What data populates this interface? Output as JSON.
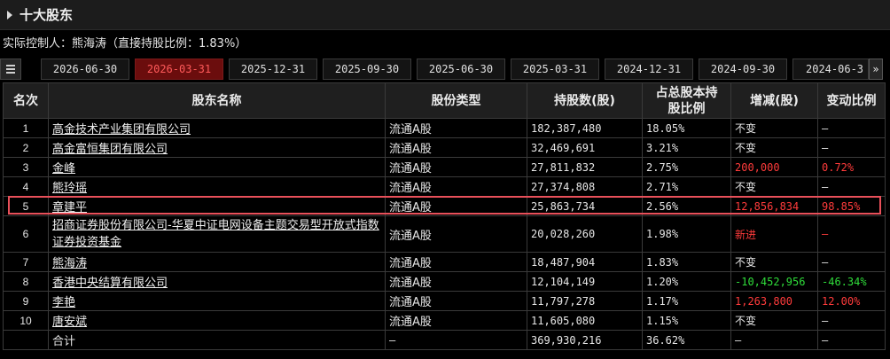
{
  "header": {
    "title": "十大股东"
  },
  "controller": {
    "text": "实际控制人：熊海涛（直接持股比例：1.83%）"
  },
  "tabs": [
    {
      "label": "2026-06-30",
      "active": false
    },
    {
      "label": "2026-03-31",
      "active": true
    },
    {
      "label": "2025-12-31",
      "active": false
    },
    {
      "label": "2025-09-30",
      "active": false
    },
    {
      "label": "2025-06-30",
      "active": false
    },
    {
      "label": "2025-03-31",
      "active": false
    },
    {
      "label": "2024-12-31",
      "active": false
    },
    {
      "label": "2024-09-30",
      "active": false
    },
    {
      "label": "2024-06-3",
      "active": false
    }
  ],
  "tab_next_icon": "double-chevron-right-icon",
  "table": {
    "headers": [
      "名次",
      "股东名称",
      "股份类型",
      "持股数(股)",
      "占总股本持股比例",
      "增减(股)",
      "变动比例"
    ],
    "rows": [
      {
        "rank": "1",
        "name": "高金技术产业集团有限公司",
        "type": "流通A股",
        "shares": "182,387,480",
        "pct": "18.05%",
        "change": "不变",
        "change_pct": "—",
        "dir": "none"
      },
      {
        "rank": "2",
        "name": "高金富恒集团有限公司",
        "type": "流通A股",
        "shares": "32,469,691",
        "pct": "3.21%",
        "change": "不变",
        "change_pct": "—",
        "dir": "none"
      },
      {
        "rank": "3",
        "name": "金峰",
        "type": "流通A股",
        "shares": "27,811,832",
        "pct": "2.75%",
        "change": "200,000",
        "change_pct": "0.72%",
        "dir": "up"
      },
      {
        "rank": "4",
        "name": "熊玲瑶",
        "type": "流通A股",
        "shares": "27,374,808",
        "pct": "2.71%",
        "change": "不变",
        "change_pct": "—",
        "dir": "none"
      },
      {
        "rank": "5",
        "name": "章建平",
        "type": "流通A股",
        "shares": "25,863,734",
        "pct": "2.56%",
        "change": "12,856,834",
        "change_pct": "98.85%",
        "dir": "up"
      },
      {
        "rank": "6",
        "name": "招商证券股份有限公司-华夏中证电网设备主题交易型开放式指数证券投资基金",
        "type": "流通A股",
        "shares": "20,028,260",
        "pct": "1.98%",
        "change": "新进",
        "change_pct": "—",
        "dir": "up"
      },
      {
        "rank": "7",
        "name": "熊海涛",
        "type": "流通A股",
        "shares": "18,487,904",
        "pct": "1.83%",
        "change": "不变",
        "change_pct": "—",
        "dir": "none"
      },
      {
        "rank": "8",
        "name": "香港中央结算有限公司",
        "type": "流通A股",
        "shares": "12,104,149",
        "pct": "1.20%",
        "change": "-10,452,956",
        "change_pct": "-46.34%",
        "dir": "down"
      },
      {
        "rank": "9",
        "name": "李艳",
        "type": "流通A股",
        "shares": "11,797,278",
        "pct": "1.17%",
        "change": "1,263,800",
        "change_pct": "12.00%",
        "dir": "up"
      },
      {
        "rank": "10",
        "name": "唐安斌",
        "type": "流通A股",
        "shares": "11,605,080",
        "pct": "1.15%",
        "change": "不变",
        "change_pct": "—",
        "dir": "none"
      }
    ],
    "total": {
      "label": "合计",
      "type": "—",
      "shares": "369,930,216",
      "pct": "36.62%",
      "change": "—",
      "change_pct": "—"
    }
  },
  "colors": {
    "up": "#ff3b3b",
    "down": "#2fdc3a",
    "active_tab": "#6b0d0d",
    "highlight_border": "#e8505a"
  }
}
